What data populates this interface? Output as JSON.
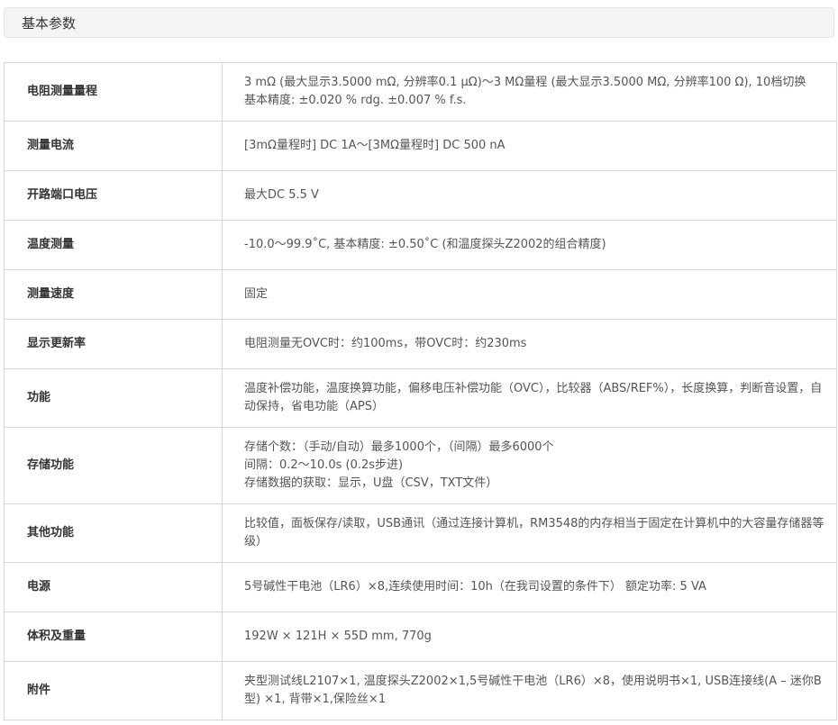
{
  "section": {
    "title": "基本参数"
  },
  "rows": [
    {
      "label": "电阻测量量程",
      "lines": [
        "3 mΩ (最大显示3.5000 mΩ, 分辨率0.1 μΩ)～3 MΩ量程 (最大显示3.5000 MΩ, 分辨率100 Ω), 10档切换",
        "基本精度: ±0.020 % rdg. ±0.007 % f.s."
      ]
    },
    {
      "label": "测量电流",
      "lines": [
        "[3mΩ量程时] DC 1A～[3MΩ量程时] DC 500 nA"
      ]
    },
    {
      "label": "开路端口电压",
      "lines": [
        "最大DC 5.5 V"
      ]
    },
    {
      "label": "温度测量",
      "lines": [
        "-10.0～99.9˚C, 基本精度: ±0.50˚C (和温度探头Z2002的组合精度)"
      ]
    },
    {
      "label": "测量速度",
      "lines": [
        "固定"
      ]
    },
    {
      "label": "显示更新率",
      "lines": [
        "电阻测量无OVC时：约100ms，带OVC时：约230ms"
      ]
    },
    {
      "label": "功能",
      "lines": [
        "温度补偿功能，温度换算功能，偏移电压补偿功能（OVC），比较器（ABS/REF%），长度换算，判断音设置，自动保持，省电功能（APS）"
      ]
    },
    {
      "label": "存储功能",
      "lines": [
        "存储个数：（手动/自动）最多1000个，（间隔）最多6000个",
        "间隔：0.2～10.0s (0.2s步进)",
        "存储数据的获取：显示，U盘（CSV，TXT文件）"
      ]
    },
    {
      "label": "其他功能",
      "lines": [
        "比较值，面板保存/读取，USB通讯（通过连接计算机，RM3548的内存相当于固定在计算机中的大容量存储器等级）"
      ]
    },
    {
      "label": "电源",
      "lines": [
        "5号碱性干电池（LR6）×8,连续使用时间：10h（在我司设置的条件下） 额定功率: 5 VA"
      ]
    },
    {
      "label": "体积及重量",
      "lines": [
        "192W × 121H × 55D mm, 770g"
      ]
    },
    {
      "label": "附件",
      "lines": [
        "夹型测试线L2107×1, 温度探头Z2002×1,5号碱性干电池（LR6）×8，使用说明书×1, USB连接线(A – 迷你B型) ×1, 背带×1,保险丝×1"
      ]
    }
  ]
}
